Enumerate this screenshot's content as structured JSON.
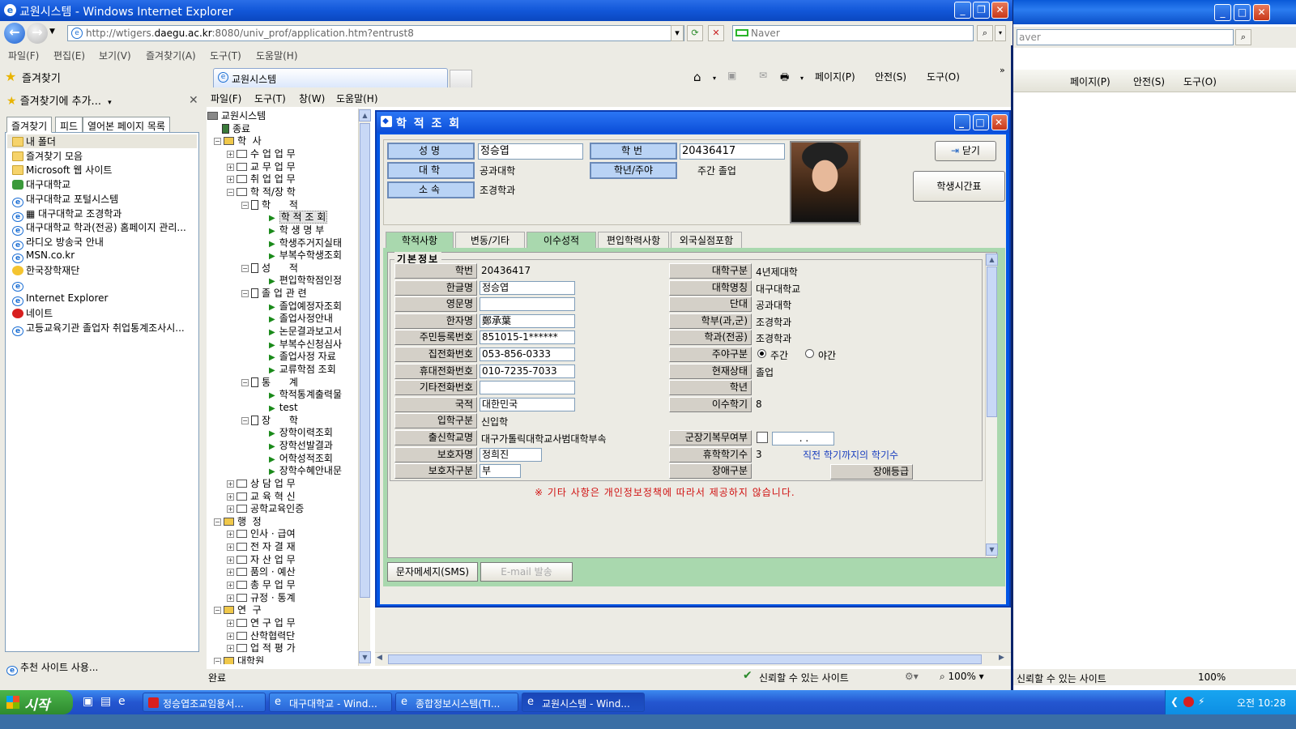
{
  "window": {
    "title": "교원시스템 - Windows Internet Explorer"
  },
  "nav": {
    "url_prefix": "http://wtigers.",
    "url_domain": "daegu.ac.kr",
    "url_rest": ":8080/univ_prof/application.htm?entrust8",
    "search_placeholder": "Naver"
  },
  "menu": [
    "파일(F)",
    "편집(E)",
    "보기(V)",
    "즐겨찾기(A)",
    "도구(T)",
    "도움말(H)"
  ],
  "favbar": {
    "label": "즐겨찾기"
  },
  "tab": {
    "label": "교원시스템"
  },
  "cmdbar": {
    "page": "페이지(P)",
    "safety": "안전(S)",
    "tools": "도구(O)"
  },
  "favpane": {
    "add_label": "즐겨찾기에 추가...",
    "tabs": [
      "즐겨찾기",
      "피드",
      "열어본 페이지 목록"
    ],
    "items": [
      {
        "label": "내 폴더",
        "icon": "folder-icon"
      },
      {
        "label": "즐겨찾기 모음",
        "icon": "folder-icon"
      },
      {
        "label": "Microsoft 웹 사이트",
        "icon": "folder-icon"
      },
      {
        "label": "대구대학교",
        "icon": "leaf-icon"
      },
      {
        "label": "대구대학교 포털시스템",
        "icon": "ie-icon"
      },
      {
        "label": "▦ 대구대학교 조경학과",
        "icon": "ie-icon"
      },
      {
        "label": "대구대학교 학과(전공) 홈페이지 관리...",
        "icon": "ie-icon"
      },
      {
        "label": "라디오 방송국 안내",
        "icon": "ie-icon"
      },
      {
        "label": "MSN.co.kr",
        "icon": "ie-icon"
      },
      {
        "label": "한국장학재단",
        "icon": "bird-icon"
      },
      {
        "label": "",
        "icon": "ie-icon"
      },
      {
        "label": "Internet Explorer",
        "icon": "ie-icon"
      },
      {
        "label": "네이트",
        "icon": "nate-icon"
      },
      {
        "label": "고등교육기관 졸업자 취업통계조사시...",
        "icon": "ie-icon"
      }
    ],
    "footer": "추천 사이트 사용..."
  },
  "appmenu": [
    "파일(F)",
    "도구(T)",
    "창(W)",
    "도움말(H)"
  ],
  "tree": [
    {
      "label": "교원시스템",
      "lvl": 0,
      "kind": "root"
    },
    {
      "label": "종료",
      "lvl": 1,
      "kind": "exit"
    },
    {
      "label": "학  사",
      "lvl": 0,
      "kind": "group",
      "pm": "−"
    },
    {
      "label": "수 업 업 무",
      "lvl": 1,
      "kind": "folder",
      "pm": "+"
    },
    {
      "label": "교 무 업 무",
      "lvl": 1,
      "kind": "folder",
      "pm": "+"
    },
    {
      "label": "취 업 업 무",
      "lvl": 1,
      "kind": "folder",
      "pm": "+"
    },
    {
      "label": "학 적/장 학",
      "lvl": 1,
      "kind": "folder",
      "pm": "−"
    },
    {
      "label": "학      적",
      "lvl": 2,
      "kind": "page",
      "pm": "−"
    },
    {
      "label": "학 적 조 회",
      "lvl": 3,
      "kind": "leaf",
      "sel": true
    },
    {
      "label": "학 생 명 부",
      "lvl": 3,
      "kind": "leaf"
    },
    {
      "label": "학생주거지실태",
      "lvl": 3,
      "kind": "leaf"
    },
    {
      "label": "부복수학생조회",
      "lvl": 3,
      "kind": "leaf"
    },
    {
      "label": "성      적",
      "lvl": 2,
      "kind": "page",
      "pm": "−"
    },
    {
      "label": "편입학학점인정",
      "lvl": 3,
      "kind": "leaf"
    },
    {
      "label": "졸 업 관 련",
      "lvl": 2,
      "kind": "page",
      "pm": "−"
    },
    {
      "label": "졸업예정자조회",
      "lvl": 3,
      "kind": "leaf"
    },
    {
      "label": "졸업사정안내",
      "lvl": 3,
      "kind": "leaf"
    },
    {
      "label": "논문결과보고서",
      "lvl": 3,
      "kind": "leaf"
    },
    {
      "label": "부복수신청심사",
      "lvl": 3,
      "kind": "leaf"
    },
    {
      "label": "졸업사정 자료",
      "lvl": 3,
      "kind": "leaf"
    },
    {
      "label": "교류학점 조회",
      "lvl": 3,
      "kind": "leaf"
    },
    {
      "label": "통      계",
      "lvl": 2,
      "kind": "page",
      "pm": "−"
    },
    {
      "label": "학적통계출력물",
      "lvl": 3,
      "kind": "leaf"
    },
    {
      "label": "test",
      "lvl": 3,
      "kind": "leaf"
    },
    {
      "label": "장      학",
      "lvl": 2,
      "kind": "page",
      "pm": "−"
    },
    {
      "label": "장학이력조회",
      "lvl": 3,
      "kind": "leaf"
    },
    {
      "label": "장학선발결과",
      "lvl": 3,
      "kind": "leaf"
    },
    {
      "label": "어학성적조회",
      "lvl": 3,
      "kind": "leaf"
    },
    {
      "label": "장학수혜안내문",
      "lvl": 3,
      "kind": "leaf"
    },
    {
      "label": "상 담 업 무",
      "lvl": 1,
      "kind": "folder",
      "pm": "+"
    },
    {
      "label": "교 육 혁 신",
      "lvl": 1,
      "kind": "folder",
      "pm": "+"
    },
    {
      "label": "공학교육인증",
      "lvl": 1,
      "kind": "folder",
      "pm": "+"
    },
    {
      "label": "행  정",
      "lvl": 0,
      "kind": "group",
      "pm": "−"
    },
    {
      "label": "인사 · 급여",
      "lvl": 1,
      "kind": "folder",
      "pm": "+"
    },
    {
      "label": "전 자 결 재",
      "lvl": 1,
      "kind": "folder",
      "pm": "+"
    },
    {
      "label": "자 산 업 무",
      "lvl": 1,
      "kind": "folder",
      "pm": "+"
    },
    {
      "label": "품의 · 예산",
      "lvl": 1,
      "kind": "folder",
      "pm": "+"
    },
    {
      "label": "총 무 업 무",
      "lvl": 1,
      "kind": "folder",
      "pm": "+"
    },
    {
      "label": "규정 · 통계",
      "lvl": 1,
      "kind": "folder",
      "pm": "+"
    },
    {
      "label": "연  구",
      "lvl": 0,
      "kind": "group",
      "pm": "−"
    },
    {
      "label": "연 구 업 무",
      "lvl": 1,
      "kind": "folder",
      "pm": "+"
    },
    {
      "label": "산학협력단",
      "lvl": 1,
      "kind": "folder",
      "pm": "+"
    },
    {
      "label": "업 적 평 가",
      "lvl": 1,
      "kind": "folder",
      "pm": "+"
    },
    {
      "label": "대학원",
      "lvl": 0,
      "kind": "group",
      "pm": "−"
    }
  ],
  "dialog": {
    "title": "학 적 조 회",
    "header": {
      "name_label": "성명",
      "name_value": "정승엽",
      "sid_label": "학번",
      "sid_value": "20436417",
      "college_label": "대학",
      "college_value": "공과대학",
      "year_label": "학년/주야",
      "year_value": "주간  졸업",
      "dept_label": "소속",
      "dept_value": "조경학과"
    },
    "close_button": "닫기",
    "timetable_button": "학생시간표",
    "tabs": [
      "학적사항",
      "변동/기타",
      "이수성적",
      "편입학력사항",
      "외국실점포함"
    ],
    "section_title": "기본정보",
    "left_fields": [
      {
        "label": "학번",
        "value": "20436417",
        "boxed": false
      },
      {
        "label": "한글명",
        "value": "정승엽",
        "boxed": true
      },
      {
        "label": "영문명",
        "value": "",
        "boxed": true
      },
      {
        "label": "한자명",
        "value": "鄭承葉",
        "boxed": true
      },
      {
        "label": "주민등록번호",
        "value": "851015-1******",
        "boxed": true
      },
      {
        "label": "집전화번호",
        "value": "053-856-0333",
        "boxed": true
      },
      {
        "label": "휴대전화번호",
        "value": "010-7235-7033",
        "boxed": true
      },
      {
        "label": "기타전화번호",
        "value": "",
        "boxed": true
      },
      {
        "label": "국적",
        "value": "대한민국",
        "boxed": true
      },
      {
        "label": "입학구분",
        "value": "신입학",
        "boxed": false
      },
      {
        "label": "출신학교명",
        "value": "대구가톨릭대학교사범대학부속",
        "boxed": false
      },
      {
        "label": "보호자명",
        "value": "정희진",
        "boxed": true
      },
      {
        "label": "보호자구분",
        "value": "부",
        "boxed": true
      }
    ],
    "right_fields": [
      {
        "label": "대학구분",
        "value": "4년제대학"
      },
      {
        "label": "대학명칭",
        "value": "대구대학교"
      },
      {
        "label": "단대",
        "value": "공과대학"
      },
      {
        "label": "학부(과,군)",
        "value": "조경학과"
      },
      {
        "label": "학과(전공)",
        "value": "조경학과"
      },
      {
        "label": "주야구분",
        "value": ""
      },
      {
        "label": "현재상태",
        "value": "졸업"
      },
      {
        "label": "학년",
        "value": ""
      },
      {
        "label": "이수학기",
        "value": "8"
      },
      {
        "label": "",
        "value": ""
      },
      {
        "label": "군장기복무여부",
        "value": ""
      },
      {
        "label": "휴학학기수",
        "value": "3"
      },
      {
        "label": "장애구분",
        "value": ""
      }
    ],
    "radio_day": "주간",
    "radio_night": "야간",
    "military_date": ".  .",
    "semester_note": "직전 학기까지의 학기수",
    "disability_grade": "장애등급",
    "privacy_notice": "※ 기타 사항은 개인정보정책에 따라서 제공하지 않습니다.",
    "sms_button": "문자메세지(SMS)",
    "email_button": "E-mail 발송"
  },
  "statusbar": {
    "left": "완료",
    "zone": "신뢰할 수 있는 사이트",
    "zoom": "100%"
  },
  "bgwindow": {
    "search": "aver",
    "page": "페이지(P)",
    "safety": "안전(S)",
    "tools": "도구(O)",
    "zone": "신뢰할 수 있는 사이트",
    "zoom": "100%"
  },
  "taskbar": {
    "start": "시작",
    "items": [
      "정승엽조교임용서...",
      "대구대학교 - Wind...",
      "종합정보시스템(TI...",
      "교원시스템 - Wind..."
    ],
    "time": "오전 10:28"
  }
}
